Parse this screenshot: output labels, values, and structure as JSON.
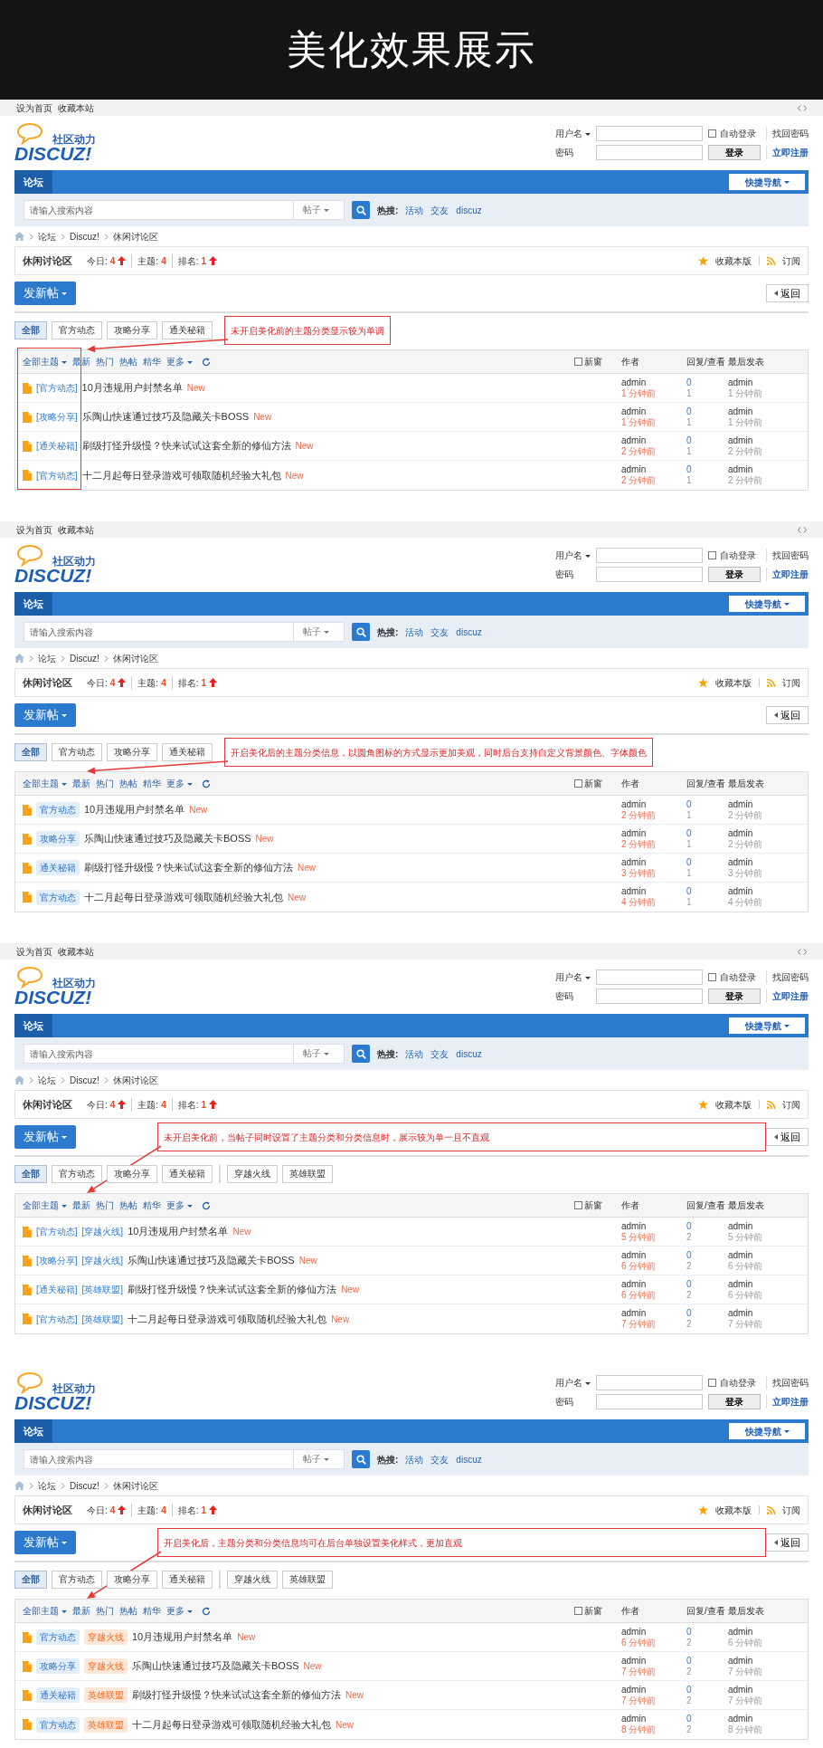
{
  "title": "美化效果展示",
  "panels": [
    {
      "top_links": [
        "设为首页",
        "收藏本站"
      ],
      "logo": {
        "tagline": "社区动力",
        "wordmark": "DISCUZ!"
      },
      "login": {
        "username_label": "用户名",
        "password_label": "密码",
        "remember": "自动登录",
        "remember_checked": false,
        "login_button": "登录",
        "forgot": "找回密码",
        "register": "立即注册"
      },
      "nav": {
        "tab": "论坛",
        "quick": "快捷导航"
      },
      "search": {
        "placeholder": "请输入搜索内容",
        "scope": "帖子",
        "hot_label": "热搜:",
        "hot": [
          "活动",
          "交友",
          "discuz"
        ]
      },
      "breadcrumb": [
        "论坛",
        "Discuz!",
        "休闲讨论区"
      ],
      "forum": {
        "name": "休闲讨论区",
        "stats": [
          {
            "label": "今日:",
            "value": "4"
          },
          {
            "label": "主题:",
            "value": "4"
          },
          {
            "label": "排名:",
            "value": "1"
          }
        ],
        "favorite": "收藏本版",
        "subscribe": "订阅"
      },
      "new_post": "发新帖",
      "back": "返回",
      "type_tabs": [
        {
          "label": "全部",
          "selected": true
        },
        {
          "label": "官方动态",
          "selected": false
        },
        {
          "label": "攻略分享",
          "selected": false
        },
        {
          "label": "通关秘籍",
          "selected": false
        }
      ],
      "note": {
        "text": "未开启美化前的主题分类显示较为单调",
        "kind": "tabs"
      },
      "highlight_types": true,
      "filters": [
        {
          "label": "全部主题",
          "dropdown": true
        },
        {
          "label": "最新",
          "dropdown": false
        },
        {
          "label": "热门",
          "dropdown": false
        },
        {
          "label": "热帖",
          "dropdown": false
        },
        {
          "label": "精华",
          "dropdown": false
        },
        {
          "label": "更多",
          "dropdown": true
        }
      ],
      "new_window": "新窗",
      "new_window_checked": false,
      "columns": [
        "作者",
        "回复/查看",
        "最后发表"
      ],
      "threads": [
        {
          "tags": [
            {
              "text": "[官方动态]",
              "kind": "plain"
            }
          ],
          "title": "10月违规用户封禁名单",
          "badge": "New",
          "author": "admin",
          "time": "1 分钟前",
          "replies": "0",
          "views": "1",
          "last_author": "admin",
          "last_time": "1 分钟前"
        },
        {
          "tags": [
            {
              "text": "[攻略分享]",
              "kind": "plain"
            }
          ],
          "title": "乐陶山快速通过技巧及隐藏关卡BOSS",
          "badge": "New",
          "author": "admin",
          "time": "1 分钟前",
          "replies": "0",
          "views": "1",
          "last_author": "admin",
          "last_time": "1 分钟前"
        },
        {
          "tags": [
            {
              "text": "[通关秘籍]",
              "kind": "plain"
            }
          ],
          "title": "刷级打怪升级慢？快来试试这套全新的修仙方法",
          "badge": "New",
          "author": "admin",
          "time": "2 分钟前",
          "replies": "0",
          "views": "1",
          "last_author": "admin",
          "last_time": "2 分钟前"
        },
        {
          "tags": [
            {
              "text": "[官方动态]",
              "kind": "plain"
            }
          ],
          "title": "十二月起每日登录游戏可领取随机经验大礼包",
          "badge": "New",
          "author": "admin",
          "time": "2 分钟前",
          "replies": "0",
          "views": "1",
          "last_author": "admin",
          "last_time": "2 分钟前"
        }
      ]
    },
    {
      "top_links": [
        "设为首页",
        "收藏本站"
      ],
      "logo": {
        "tagline": "社区动力",
        "wordmark": "DISCUZ!"
      },
      "login": {
        "username_label": "用户名",
        "password_label": "密码",
        "remember": "自动登录",
        "remember_checked": false,
        "login_button": "登录",
        "forgot": "找回密码",
        "register": "立即注册"
      },
      "nav": {
        "tab": "论坛",
        "quick": "快捷导航"
      },
      "search": {
        "placeholder": "请输入搜索内容",
        "scope": "帖子",
        "hot_label": "热搜:",
        "hot": [
          "活动",
          "交友",
          "discuz"
        ]
      },
      "breadcrumb": [
        "论坛",
        "Discuz!",
        "休闲讨论区"
      ],
      "forum": {
        "name": "休闲讨论区",
        "stats": [
          {
            "label": "今日:",
            "value": "4"
          },
          {
            "label": "主题:",
            "value": "4"
          },
          {
            "label": "排名:",
            "value": "1"
          }
        ],
        "favorite": "收藏本版",
        "subscribe": "订阅"
      },
      "new_post": "发新帖",
      "back": "返回",
      "type_tabs": [
        {
          "label": "全部",
          "selected": true
        },
        {
          "label": "官方动态",
          "selected": false
        },
        {
          "label": "攻略分享",
          "selected": false
        },
        {
          "label": "通关秘籍",
          "selected": false
        }
      ],
      "note": {
        "text": "开启美化后的主题分类信息，以圆角图标的方式显示更加美观，同时后台支持自定义背景颜色、字体颜色",
        "kind": "tabs"
      },
      "filters": [
        {
          "label": "全部主题",
          "dropdown": true
        },
        {
          "label": "最新",
          "dropdown": false
        },
        {
          "label": "热门",
          "dropdown": false
        },
        {
          "label": "热帖",
          "dropdown": false
        },
        {
          "label": "精华",
          "dropdown": false
        },
        {
          "label": "更多",
          "dropdown": true
        }
      ],
      "new_window": "新窗",
      "new_window_checked": false,
      "columns": [
        "作者",
        "回复/查看",
        "最后发表"
      ],
      "threads": [
        {
          "tags": [
            {
              "text": "官方动态",
              "kind": "type"
            }
          ],
          "title": "10月违规用户封禁名单",
          "badge": "New",
          "author": "admin",
          "time": "2 分钟前",
          "replies": "0",
          "views": "1",
          "last_author": "admin",
          "last_time": "2 分钟前"
        },
        {
          "tags": [
            {
              "text": "攻略分享",
              "kind": "type"
            }
          ],
          "title": "乐陶山快速通过技巧及隐藏关卡BOSS",
          "badge": "New",
          "author": "admin",
          "time": "2 分钟前",
          "replies": "0",
          "views": "1",
          "last_author": "admin",
          "last_time": "2 分钟前"
        },
        {
          "tags": [
            {
              "text": "通关秘籍",
              "kind": "type"
            }
          ],
          "title": "刷级打怪升级慢？快来试试这套全新的修仙方法",
          "badge": "New",
          "author": "admin",
          "time": "3 分钟前",
          "replies": "0",
          "views": "1",
          "last_author": "admin",
          "last_time": "3 分钟前"
        },
        {
          "tags": [
            {
              "text": "官方动态",
              "kind": "type"
            }
          ],
          "title": "十二月起每日登录游戏可领取随机经验大礼包",
          "badge": "New",
          "author": "admin",
          "time": "4 分钟前",
          "replies": "0",
          "views": "1",
          "last_author": "admin",
          "last_time": "4 分钟前"
        }
      ]
    },
    {
      "top_links": [
        "设为首页",
        "收藏本站"
      ],
      "logo": {
        "tagline": "社区动力",
        "wordmark": "DISCUZ!"
      },
      "login": {
        "username_label": "用户名",
        "password_label": "密码",
        "remember": "自动登录",
        "remember_checked": false,
        "login_button": "登录",
        "forgot": "找回密码",
        "register": "立即注册"
      },
      "nav": {
        "tab": "论坛",
        "quick": "快捷导航"
      },
      "search": {
        "placeholder": "请输入搜索内容",
        "scope": "帖子",
        "hot_label": "热搜:",
        "hot": [
          "活动",
          "交友",
          "discuz"
        ]
      },
      "breadcrumb": [
        "论坛",
        "Discuz!",
        "休闲讨论区"
      ],
      "forum": {
        "name": "休闲讨论区",
        "stats": [
          {
            "label": "今日:",
            "value": "4"
          },
          {
            "label": "主题:",
            "value": "4"
          },
          {
            "label": "排名:",
            "value": "1"
          }
        ],
        "favorite": "收藏本版",
        "subscribe": "订阅"
      },
      "new_post": "发新帖",
      "back": "返回",
      "type_tabs": [
        {
          "label": "全部",
          "selected": true
        },
        {
          "label": "官方动态",
          "selected": false
        },
        {
          "label": "攻略分享",
          "selected": false
        },
        {
          "label": "通关秘籍",
          "selected": false
        }
      ],
      "sort_tabs": [
        {
          "label": "穿越火线",
          "selected": false
        },
        {
          "label": "英雄联盟",
          "selected": false
        }
      ],
      "note": {
        "text": "未开启美化前，当帖子同时设置了主题分类和分类信息时，展示较为单一且不直观",
        "kind": "toolbar"
      },
      "filters": [
        {
          "label": "全部主题",
          "dropdown": true
        },
        {
          "label": "最新",
          "dropdown": false
        },
        {
          "label": "热门",
          "dropdown": false
        },
        {
          "label": "热帖",
          "dropdown": false
        },
        {
          "label": "精华",
          "dropdown": false
        },
        {
          "label": "更多",
          "dropdown": true
        }
      ],
      "new_window": "新窗",
      "new_window_checked": false,
      "columns": [
        "作者",
        "回复/查看",
        "最后发表"
      ],
      "threads": [
        {
          "tags": [
            {
              "text": "[官方动态]",
              "kind": "plain"
            },
            {
              "text": "[穿越火线]",
              "kind": "plain"
            }
          ],
          "title": "10月违规用户封禁名单",
          "badge": "New",
          "author": "admin",
          "time": "5 分钟前",
          "replies": "0",
          "views": "2",
          "last_author": "admin",
          "last_time": "5 分钟前"
        },
        {
          "tags": [
            {
              "text": "[攻略分享]",
              "kind": "plain"
            },
            {
              "text": "[穿越火线]",
              "kind": "plain"
            }
          ],
          "title": "乐陶山快速通过技巧及隐藏关卡BOSS",
          "badge": "New",
          "author": "admin",
          "time": "6 分钟前",
          "replies": "0",
          "views": "2",
          "last_author": "admin",
          "last_time": "6 分钟前"
        },
        {
          "tags": [
            {
              "text": "[通关秘籍]",
              "kind": "plain"
            },
            {
              "text": "[英雄联盟]",
              "kind": "plain"
            }
          ],
          "title": "刷级打怪升级慢？快来试试这套全新的修仙方法",
          "badge": "New",
          "author": "admin",
          "time": "6 分钟前",
          "replies": "0",
          "views": "2",
          "last_author": "admin",
          "last_time": "6 分钟前"
        },
        {
          "tags": [
            {
              "text": "[官方动态]",
              "kind": "plain"
            },
            {
              "text": "[英雄联盟]",
              "kind": "plain"
            }
          ],
          "title": "十二月起每日登录游戏可领取随机经验大礼包",
          "badge": "New",
          "author": "admin",
          "time": "7 分钟前",
          "replies": "0",
          "views": "2",
          "last_author": "admin",
          "last_time": "7 分钟前"
        }
      ]
    },
    {
      "logo": {
        "tagline": "社区动力",
        "wordmark": "DISCUZ!"
      },
      "login": {
        "username_label": "用户名",
        "password_label": "密码",
        "remember": "自动登录",
        "remember_checked": false,
        "login_button": "登录",
        "forgot": "找回密码",
        "register": "立即注册"
      },
      "nav": {
        "tab": "论坛",
        "quick": "快捷导航"
      },
      "search": {
        "placeholder": "请输入搜索内容",
        "scope": "帖子",
        "hot_label": "热搜:",
        "hot": [
          "活动",
          "交友",
          "discuz"
        ]
      },
      "breadcrumb": [
        "论坛",
        "Discuz!",
        "休闲讨论区"
      ],
      "forum": {
        "name": "休闲讨论区",
        "stats": [
          {
            "label": "今日:",
            "value": "4"
          },
          {
            "label": "主题:",
            "value": "4"
          },
          {
            "label": "排名:",
            "value": "1"
          }
        ],
        "favorite": "收藏本版",
        "subscribe": "订阅"
      },
      "new_post": "发新帖",
      "back": "返回",
      "type_tabs": [
        {
          "label": "全部",
          "selected": true
        },
        {
          "label": "官方动态",
          "selected": false
        },
        {
          "label": "攻略分享",
          "selected": false
        },
        {
          "label": "通关秘籍",
          "selected": false
        }
      ],
      "sort_tabs": [
        {
          "label": "穿越火线",
          "selected": false
        },
        {
          "label": "英雄联盟",
          "selected": false
        }
      ],
      "note": {
        "text": "开启美化后，主题分类和分类信息均可在后台单独设置美化样式，更加直观",
        "kind": "toolbar"
      },
      "filters": [
        {
          "label": "全部主题",
          "dropdown": true
        },
        {
          "label": "最新",
          "dropdown": false
        },
        {
          "label": "热门",
          "dropdown": false
        },
        {
          "label": "热帖",
          "dropdown": false
        },
        {
          "label": "精华",
          "dropdown": false
        },
        {
          "label": "更多",
          "dropdown": true
        }
      ],
      "new_window": "新窗",
      "new_window_checked": false,
      "columns": [
        "作者",
        "回复/查看",
        "最后发表"
      ],
      "threads": [
        {
          "tags": [
            {
              "text": "官方动态",
              "kind": "type"
            },
            {
              "text": "穿越火线",
              "kind": "sort"
            }
          ],
          "title": "10月违规用户封禁名单",
          "badge": "New",
          "author": "admin",
          "time": "6 分钟前",
          "replies": "0",
          "views": "2",
          "last_author": "admin",
          "last_time": "6 分钟前"
        },
        {
          "tags": [
            {
              "text": "攻略分享",
              "kind": "type"
            },
            {
              "text": "穿越火线",
              "kind": "sort"
            }
          ],
          "title": "乐陶山快速通过技巧及隐藏关卡BOSS",
          "badge": "New",
          "author": "admin",
          "time": "7 分钟前",
          "replies": "0",
          "views": "2",
          "last_author": "admin",
          "last_time": "7 分钟前"
        },
        {
          "tags": [
            {
              "text": "通关秘籍",
              "kind": "type"
            },
            {
              "text": "英雄联盟",
              "kind": "sort"
            }
          ],
          "title": "刷级打怪升级慢？快来试试这套全新的修仙方法",
          "badge": "New",
          "author": "admin",
          "time": "7 分钟前",
          "replies": "0",
          "views": "2",
          "last_author": "admin",
          "last_time": "7 分钟前"
        },
        {
          "tags": [
            {
              "text": "官方动态",
              "kind": "type"
            },
            {
              "text": "英雄联盟",
              "kind": "sort"
            }
          ],
          "title": "十二月起每日登录游戏可领取随机经验大礼包",
          "badge": "New",
          "author": "admin",
          "time": "8 分钟前",
          "replies": "0",
          "views": "2",
          "last_author": "admin",
          "last_time": "8 分钟前"
        }
      ]
    }
  ]
}
